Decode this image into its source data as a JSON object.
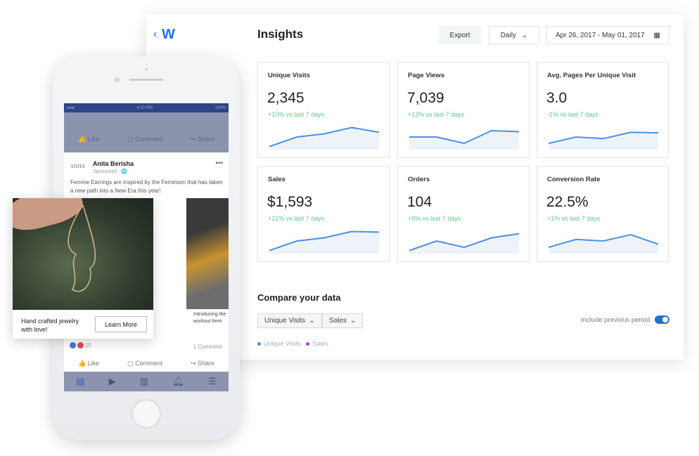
{
  "header": {
    "logo": "W",
    "title": "Insights",
    "export_label": "Export",
    "interval": "Daily",
    "date_range": "Apr 26, 2017 - May 01, 2017"
  },
  "cards": [
    {
      "label": "Unique Visits",
      "value": "2,345",
      "change": "+10% vs last 7 days",
      "trend": [
        1,
        4,
        5,
        7,
        5.5
      ]
    },
    {
      "label": "Page Views",
      "value": "7,039",
      "change": "+12% vs last 7 days",
      "trend": [
        4,
        4,
        2,
        6,
        5.7
      ]
    },
    {
      "label": "Avg. Pages Per Unique Visit",
      "value": "3.0",
      "change": "-1% vs last 7 days",
      "trend": [
        2,
        4,
        3.5,
        5.5,
        5.3
      ]
    },
    {
      "label": "Sales",
      "value": "$1,593",
      "change": "+21% vs last 7 days",
      "trend": [
        1,
        4,
        5,
        7,
        6.8
      ]
    },
    {
      "label": "Orders",
      "value": "104",
      "change": "+9% vs last 7 days",
      "trend": [
        1,
        4,
        2,
        5,
        6.3
      ]
    },
    {
      "label": "Conversion Rate",
      "value": "22.5%",
      "change": "+1% vs last 7 days",
      "trend": [
        2,
        4.5,
        4,
        6,
        3
      ]
    }
  ],
  "compare": {
    "title": "Compare your data",
    "select1": "Unique Visits",
    "select2": "Sales",
    "legend": [
      {
        "name": "Unique Visits",
        "color": "#4a90e2"
      },
      {
        "name": "Sales",
        "color": "#b03bd1"
      }
    ],
    "include_label": "Include previous period",
    "include_on": true
  },
  "colors": {
    "accent": "#1e73d8",
    "line": "#4a90e2",
    "positive": "#5cc98a"
  },
  "phone": {
    "status_time": "4:22 PM",
    "status_battery": "100%",
    "top_actions": [
      "Like",
      "Comment",
      "Share"
    ],
    "post": {
      "page_logo": "ANITA",
      "author": "Anita Berisha",
      "sponsored": "Sponsored · ",
      "text": "Femme Earrings are inspired by the Feminism that has taken a new path into a New Era this year!"
    },
    "ad": {
      "caption": "Hand crafted jewelry with love!",
      "cta": "Learn More"
    },
    "carousel2_caption": "Introducing the workout form",
    "reactions": "15",
    "comments": "1 Comment",
    "bottom_actions": [
      "Like",
      "Comment",
      "Share"
    ],
    "tabs": [
      "news-feed-icon",
      "watch-icon",
      "marketplace-icon",
      "notifications-icon",
      "menu-icon"
    ]
  }
}
